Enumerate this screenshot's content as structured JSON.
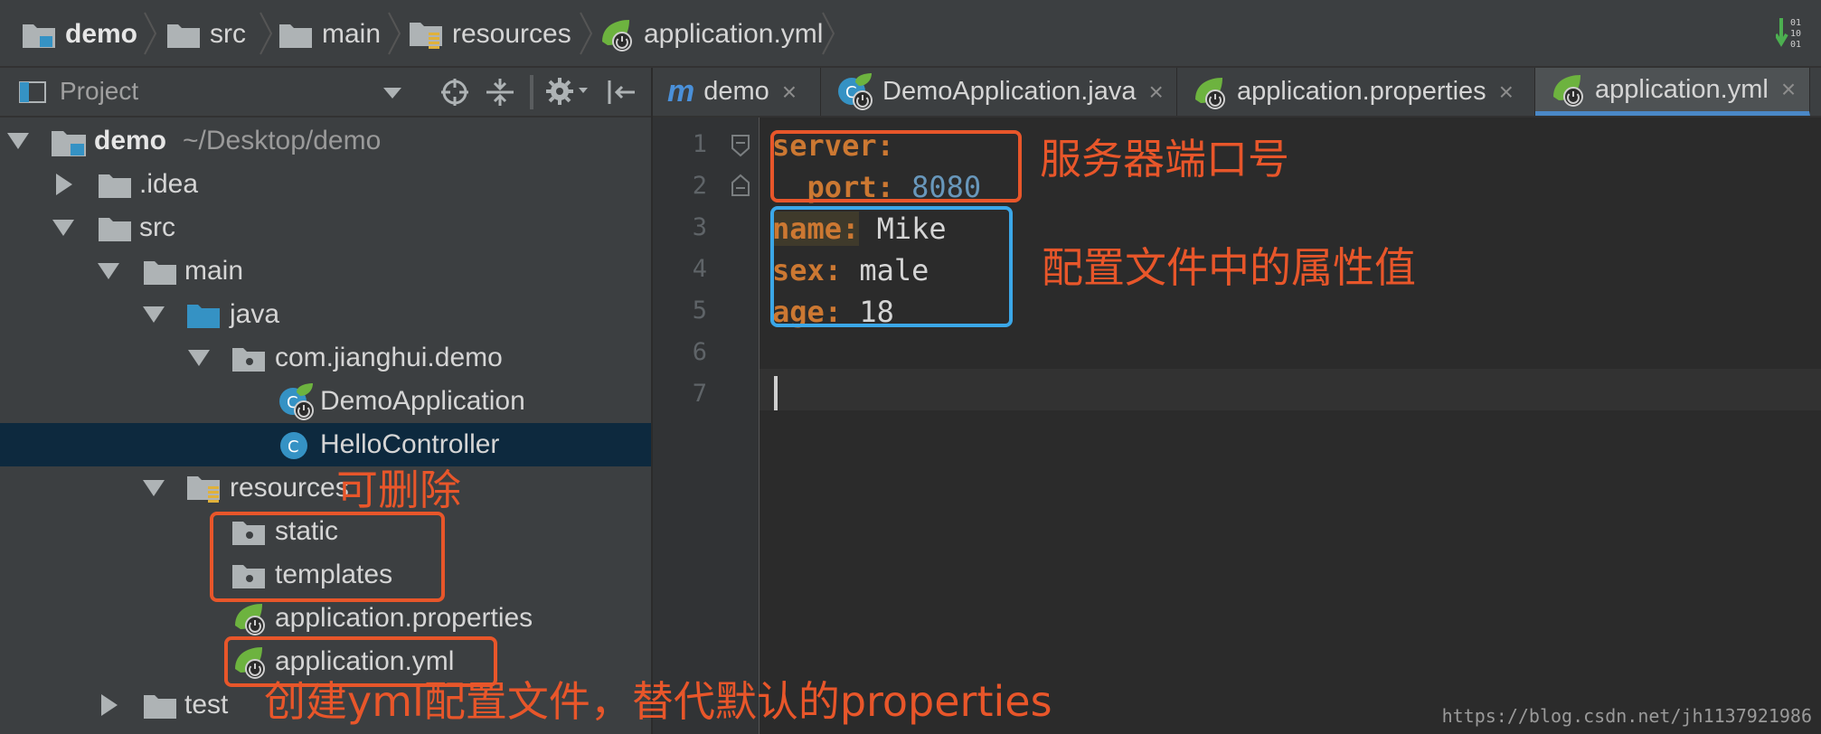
{
  "breadcrumb": {
    "items": [
      {
        "label": "demo",
        "icon": "module-folder-icon"
      },
      {
        "label": "src",
        "icon": "folder-icon"
      },
      {
        "label": "main",
        "icon": "folder-icon"
      },
      {
        "label": "resources",
        "icon": "resources-folder-icon"
      },
      {
        "label": "application.yml",
        "icon": "spring-boot-icon"
      }
    ],
    "right_icon": "binary-update-icon"
  },
  "project_panel": {
    "title": "Project",
    "toolbar_icons": [
      "locate-icon",
      "collapse-all-icon",
      "settings-gear-icon",
      "hide-panel-icon"
    ]
  },
  "tree": {
    "root_label": "demo",
    "root_path": "~/Desktop/demo",
    "items": [
      {
        "label": ".idea"
      },
      {
        "label": "src"
      },
      {
        "label": "main"
      },
      {
        "label": "java"
      },
      {
        "label": "com.jianghui.demo"
      },
      {
        "label": "DemoApplication"
      },
      {
        "label": "HelloController"
      },
      {
        "label": "resources"
      },
      {
        "label": "static"
      },
      {
        "label": "templates"
      },
      {
        "label": "application.properties"
      },
      {
        "label": "application.yml"
      },
      {
        "label": "test"
      }
    ]
  },
  "tabs": [
    {
      "label": "demo",
      "icon": "maven-m-icon"
    },
    {
      "label": "DemoApplication.java",
      "icon": "spring-boot-class-icon"
    },
    {
      "label": "application.properties",
      "icon": "spring-boot-icon"
    },
    {
      "label": "application.yml",
      "icon": "spring-boot-icon",
      "active": true
    }
  ],
  "tab_close": "×",
  "editor": {
    "line_numbers": [
      "1",
      "2",
      "3",
      "4",
      "5",
      "6",
      "7"
    ],
    "lines": [
      {
        "key": "server:",
        "value": ""
      },
      {
        "key": "  port:",
        "value": "8080"
      },
      {
        "key": "name:",
        "value": "Mike"
      },
      {
        "key": "sex:",
        "value": "male"
      },
      {
        "key": "age:",
        "value": "18"
      }
    ]
  },
  "annotations": {
    "server_port": "服务器端口号",
    "config_values": "配置文件中的属性值",
    "deletable": "可删除",
    "create_yml": "创建yml配置文件，替代默认的properties"
  },
  "watermark": "https://blog.csdn.net/jh1137921986",
  "colors": {
    "accent_orange": "#e8562a",
    "accent_blue": "#3ba7e8",
    "yaml_key": "#cc7832",
    "yaml_number": "#6897bb"
  }
}
